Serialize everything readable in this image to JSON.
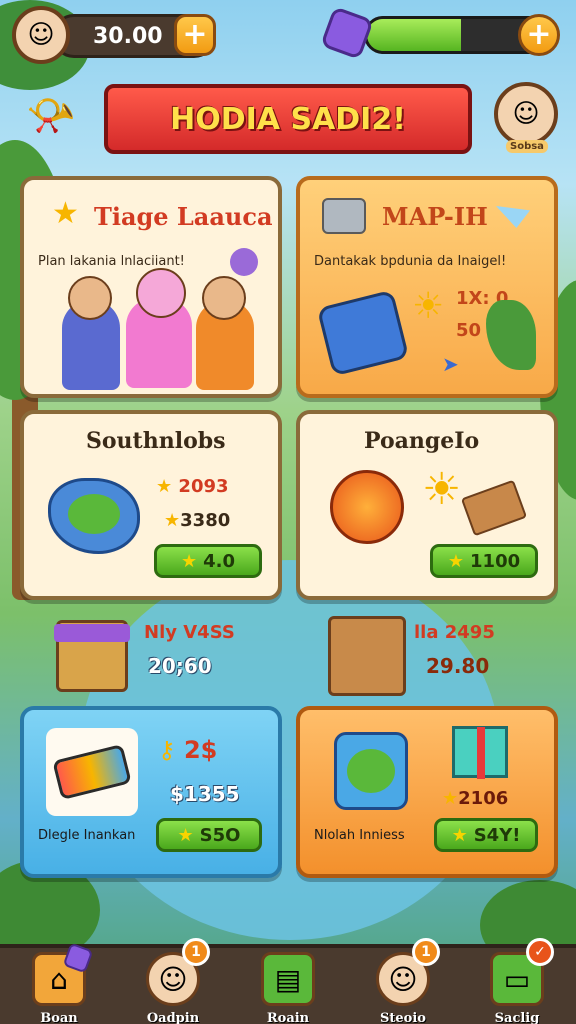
{
  "top_bar": {
    "coins": "30.00",
    "energy_fraction": 0.52,
    "plus_label": "+"
  },
  "banner": {
    "title": "HODIA SADI2!"
  },
  "mini_profile": {
    "label": "Sobsa"
  },
  "cards": {
    "team": {
      "title": "Tiage Laauca",
      "subtitle": "Plan lakania lnlaciiant!"
    },
    "map": {
      "title": "MAP-IH",
      "subtitle": "Dantakak bpdunia da Inaigel!",
      "value1": "1X: 0",
      "value2": "50"
    },
    "southnlobs": {
      "title": "Southnlobs",
      "stat1": "2093",
      "stat2": "3380",
      "button": "4.0"
    },
    "poangeio": {
      "title": "PoangeIo",
      "button": "1100"
    },
    "chest_left": {
      "title": "Nly V4SS",
      "value": "20;60"
    },
    "chest_right": {
      "title": "lla 2495",
      "value": "29.80"
    },
    "phone": {
      "title": "2$",
      "price": "$1355",
      "label": "Dlegle Inankan",
      "button": "S5O"
    },
    "gift": {
      "stat": "2106",
      "label": "Nlolah Inniess",
      "button": "S4Y!"
    }
  },
  "nav": [
    {
      "label": "Boan",
      "icon": "house-icon",
      "badge": ""
    },
    {
      "label": "Oadpin",
      "icon": "profile-icon",
      "badge": "1"
    },
    {
      "label": "Roain",
      "icon": "shop-icon",
      "badge": ""
    },
    {
      "label": "Steoio",
      "icon": "friend-icon",
      "badge": "1"
    },
    {
      "label": "Saclig",
      "icon": "card-icon",
      "badge": "✓"
    }
  ],
  "colors": {
    "banner": "#d42a2a",
    "banner_text": "#ffe04a",
    "card_cream": "#fff3db",
    "card_orange": "#f8a948",
    "card_blue": "#48b0e6",
    "button_green": "#4aa81c"
  }
}
